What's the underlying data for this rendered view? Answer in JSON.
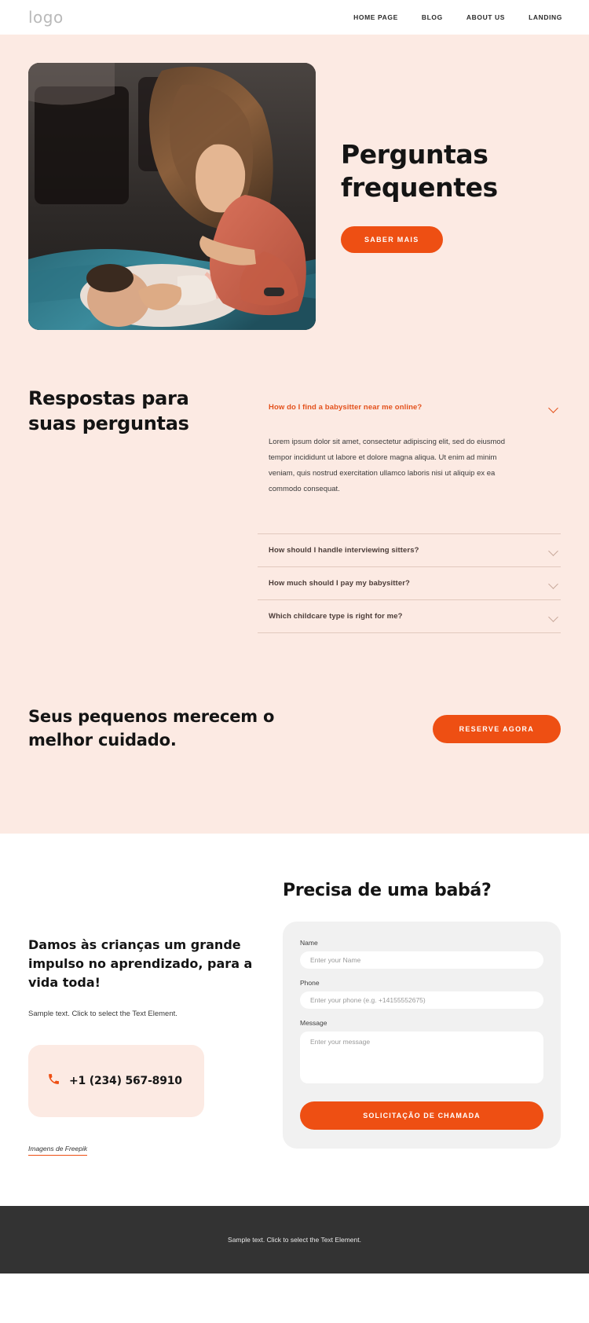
{
  "header": {
    "logo": "logo",
    "nav": [
      {
        "label": "HOME PAGE"
      },
      {
        "label": "BLOG"
      },
      {
        "label": "ABOUT US"
      },
      {
        "label": "LANDING"
      }
    ]
  },
  "hero": {
    "title": "Perguntas frequentes",
    "cta_label": "SABER MAIS",
    "image_alt": "Mother playing with baby on floor"
  },
  "faq": {
    "heading": "Respostas para suas perguntas",
    "items": [
      {
        "question": "How do I find a babysitter near me online?",
        "answer": "Lorem ipsum dolor sit amet, consectetur adipiscing elit, sed do eiusmod tempor incididunt ut labore et dolore magna aliqua. Ut enim ad minim veniam, quis nostrud exercitation ullamco laboris nisi ut aliquip ex ea commodo consequat.",
        "open": true
      },
      {
        "question": "How should I handle interviewing sitters?",
        "answer": "",
        "open": false
      },
      {
        "question": "How much should I pay my babysitter?",
        "answer": "",
        "open": false
      },
      {
        "question": "Which childcare type is right for me?",
        "answer": "",
        "open": false
      }
    ]
  },
  "cta_band": {
    "title": "Seus pequenos merecem o melhor cuidado.",
    "button_label": "RESERVE AGORA"
  },
  "contact": {
    "title": "Damos às crianças um grande impulso no aprendizado, para a vida toda!",
    "subtitle": "Sample text. Click to select the Text Element.",
    "phone": "+1 (234) 567-8910",
    "credit": "Imagens de Freepik"
  },
  "form": {
    "title": "Precisa de uma babá?",
    "name_label": "Name",
    "name_placeholder": "Enter your Name",
    "phone_label": "Phone",
    "phone_placeholder": "Enter your phone (e.g. +14155552675)",
    "message_label": "Message",
    "message_placeholder": "Enter your message",
    "submit_label": "SOLICITAÇÃO DE CHAMADA"
  },
  "footer": {
    "text": "Sample text. Click to select the Text Element."
  },
  "colors": {
    "accent": "#EE4F13",
    "peach": "#FCEAE3",
    "footer_bg": "#333333",
    "form_bg": "#F1F1F1",
    "faq_active": "#E3511C"
  }
}
